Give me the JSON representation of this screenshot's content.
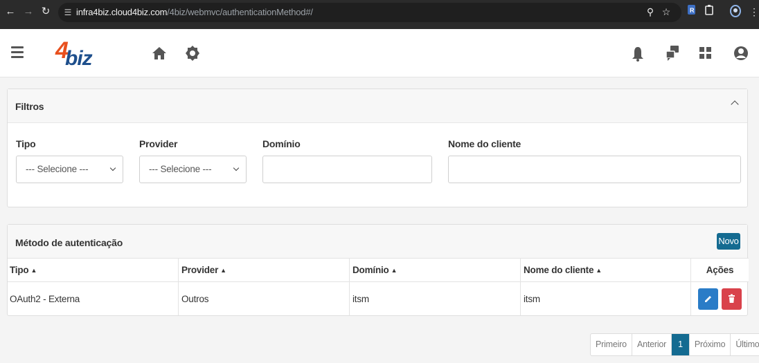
{
  "browser": {
    "url_host": "infra4biz.cloud4biz.com",
    "url_path": "/4biz/webmvc/authenticationMethod#/"
  },
  "app": {
    "logo_number": "4",
    "logo_text": "biz"
  },
  "filters": {
    "title": "Filtros",
    "tipo_label": "Tipo",
    "tipo_value": "--- Selecione ---",
    "provider_label": "Provider",
    "provider_value": "--- Selecione ---",
    "dominio_label": "Domínio",
    "dominio_value": "",
    "cliente_label": "Nome do cliente",
    "cliente_value": ""
  },
  "table": {
    "title": "Método de autenticação",
    "new_button": "Novo",
    "columns": [
      "Tipo",
      "Provider",
      "Domínio",
      "Nome do cliente",
      "Ações"
    ],
    "rows": [
      {
        "tipo": "OAuth2 - Externa",
        "provider": "Outros",
        "dominio": "itsm",
        "cliente": "itsm"
      }
    ]
  },
  "pagination": {
    "first": "Primeiro",
    "prev": "Anterior",
    "current": "1",
    "next": "Próximo",
    "last": "Último"
  },
  "colors": {
    "primary": "#146b91",
    "edit_button": "#2a7cc7",
    "delete_button": "#d9424b"
  }
}
